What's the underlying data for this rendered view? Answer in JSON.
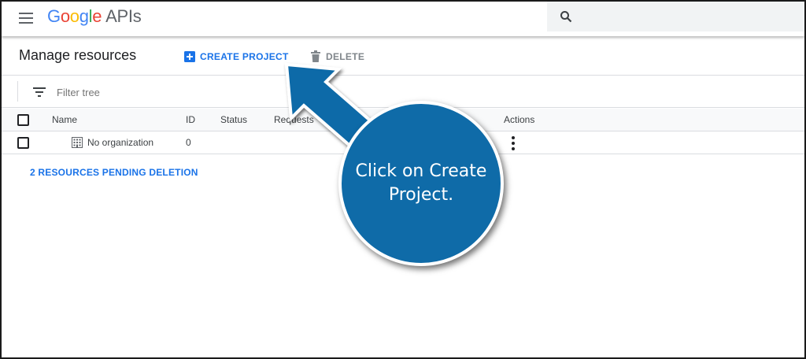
{
  "appbar": {
    "logo_letters": [
      "G",
      "o",
      "o",
      "g",
      "l",
      "e"
    ],
    "logo_suffix": "APIs",
    "search_icon": "search-icon",
    "menu_icon": "menu-icon"
  },
  "header": {
    "title": "Manage resources",
    "create_label": "CREATE PROJECT",
    "delete_label": "DELETE",
    "create_icon": "add-box-icon",
    "delete_icon": "trash-icon"
  },
  "filter": {
    "placeholder": "Filter tree",
    "icon": "filter-icon"
  },
  "table": {
    "columns": [
      "Name",
      "ID",
      "Status",
      "Requests",
      "",
      "Actions"
    ],
    "rows": [
      {
        "name": "No organization",
        "id": "0",
        "status": "",
        "requests": ""
      }
    ]
  },
  "pending_link": "2 RESOURCES PENDING DELETION",
  "callout": {
    "text": "Click on Create Project."
  },
  "colors": {
    "accent": "#1a73e8",
    "callout": "#0f6ba8",
    "muted": "#80868b"
  }
}
